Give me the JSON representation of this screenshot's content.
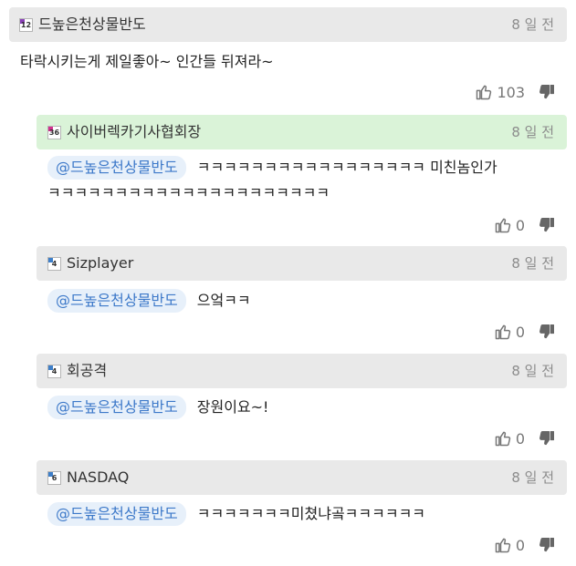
{
  "colors": {
    "header_bg": "#e9e9e9",
    "header_highlight_bg": "#daf3d8",
    "mention_bg": "#e7f0fa",
    "mention_text": "#3d79c9",
    "time_text": "#8c8c8c"
  },
  "comments": [
    {
      "username": "드높은천상물반도",
      "level": "12",
      "level_color": "#8a3fb8",
      "time": "8 일 전",
      "text": "타락시키는게 제일좋아~ 인간들 뒤져라~",
      "upvotes": "103",
      "up_icon": "thumbs-up-icon",
      "down_icon": "thumbs-down-icon"
    }
  ],
  "replies": [
    {
      "username": "사이버렉카기사협회장",
      "level": "36",
      "level_color": "#d4308e",
      "time": "8 일 전",
      "mention": "@드높은천상물반도",
      "text_line1": "ㅋㅋㅋㅋㅋㅋㅋㅋㅋㅋㅋㅋㅋㅋㅋㅋㅋ 미친놈인가",
      "text_line2": "ㅋㅋㅋㅋㅋㅋㅋㅋㅋㅋㅋㅋㅋㅋㅋㅋㅋㅋㅋㅋㅋ",
      "upvotes": "0"
    },
    {
      "username": "Sizplayer",
      "level": "4",
      "level_color": "#3e7fc9",
      "time": "8 일 전",
      "mention": "@드높은천상물반도",
      "text_line1": "으엌ㅋㅋ",
      "upvotes": "0"
    },
    {
      "username": "회공격",
      "level": "4",
      "level_color": "#3e7fc9",
      "time": "8 일 전",
      "mention": "@드높은천상물반도",
      "text_line1": "장원이요~!",
      "upvotes": "0"
    },
    {
      "username": "NASDAQ",
      "level": "6",
      "level_color": "#3e7fc9",
      "time": "8 일 전",
      "mention": "@드높은천상물반도",
      "text_line1": "ㅋㅋㅋㅋㅋㅋㅋ미쳤냐곸ㅋㅋㅋㅋㅋㅋ",
      "upvotes": "0"
    }
  ]
}
